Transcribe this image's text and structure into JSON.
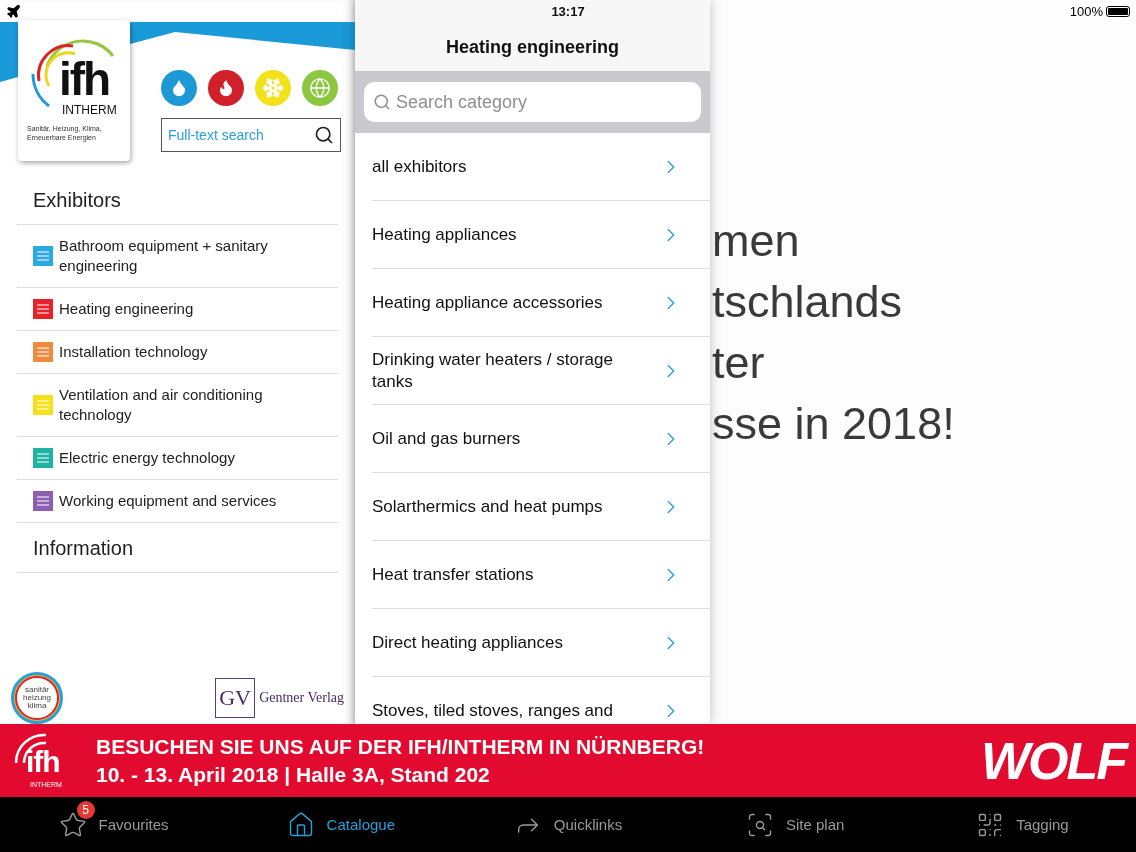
{
  "status_bar": {
    "time": "13:17",
    "battery": "100%"
  },
  "logo": {
    "name": "ifh",
    "subname": "INTHERM",
    "tagline": "Sanitär, Heizung, Klima, Erneuerbare Energien"
  },
  "quick_filters": [
    {
      "kind": "drop",
      "color": "#1d9ad6"
    },
    {
      "kind": "flame",
      "color": "#d0202b"
    },
    {
      "kind": "snow",
      "color": "#f2e21a"
    },
    {
      "kind": "globe",
      "color": "#8dc63f"
    }
  ],
  "search": {
    "placeholder": "Full-text search"
  },
  "menu": [
    {
      "title": "Exhibitors",
      "items": [
        {
          "label": "Bathroom equipment + sanitary engineering",
          "color": "#29a9e1"
        },
        {
          "label": "Heating engineering",
          "color": "#e8222b"
        },
        {
          "label": "Installation technology",
          "color": "#f08a3c"
        },
        {
          "label": "Ventilation and air conditioning technology",
          "color": "#f5e11b"
        },
        {
          "label": "Electric energy technology",
          "color": "#1fb3a4"
        },
        {
          "label": "Working equipment and services",
          "color": "#8d5fb0"
        }
      ]
    },
    {
      "title": "Information"
    }
  ],
  "sponsors": {
    "badge_text": "sanitär heizung klima",
    "publisher_mark": "GV",
    "publisher": "Gentner Verlag"
  },
  "category_panel": {
    "title": "Heating engineering",
    "search_placeholder": "Search category",
    "items": [
      "all exhibitors",
      "Heating appliances",
      "Heating appliance accessories",
      "Drinking water heaters / storage tanks",
      "Oil and gas burners",
      "Solarthermics and heat pumps",
      "Heat transfer stations",
      "Direct heating appliances",
      "Stoves, tiled stoves, ranges and"
    ]
  },
  "background_text": [
    "men",
    "tschlands",
    "ter",
    "sse in 2018!"
  ],
  "banner": {
    "logo_name": "ifh",
    "logo_sub": "INTHERM",
    "lines": [
      "BESUCHEN SIE UNS AUF DER IFH/INTHERM IN NÜRNBERG!",
      "10. - 13. April 2018 | Halle 3A, Stand 202"
    ],
    "brand": "WOLF"
  },
  "tabs": [
    {
      "label": "Favourites",
      "kind": "star",
      "badge": "5",
      "selected": false
    },
    {
      "label": "Catalogue",
      "kind": "home",
      "selected": true
    },
    {
      "label": "Quicklinks",
      "kind": "share",
      "selected": false
    },
    {
      "label": "Site plan",
      "kind": "plan",
      "selected": false
    },
    {
      "label": "Tagging",
      "kind": "qr",
      "selected": false
    }
  ]
}
